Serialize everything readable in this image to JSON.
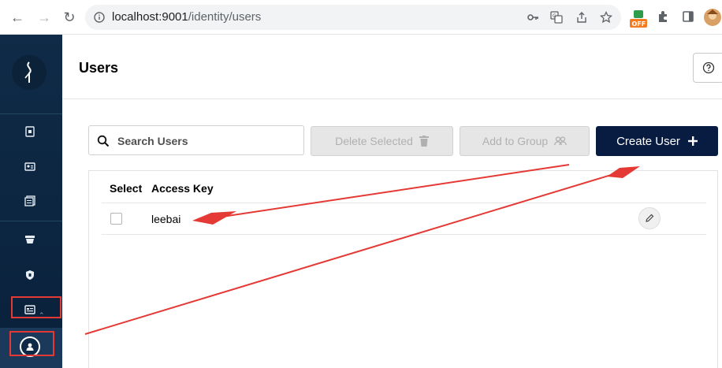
{
  "browser": {
    "url_host": "localhost:9001",
    "url_path": "/identity/users",
    "ext_badge": "OFF"
  },
  "sidebar": {
    "items": [
      {
        "icon": "buckets-icon"
      },
      {
        "icon": "access-keys-icon"
      },
      {
        "icon": "documentation-icon"
      },
      {
        "icon": "tiers-icon"
      },
      {
        "icon": "policies-icon"
      },
      {
        "icon": "identity-icon"
      },
      {
        "icon": "user-avatar-icon"
      }
    ]
  },
  "page": {
    "title": "Users"
  },
  "toolbar": {
    "search_placeholder": "Search Users",
    "delete_label": "Delete Selected",
    "add_group_label": "Add to Group",
    "create_label": "Create User"
  },
  "table": {
    "columns": [
      "Select",
      "Access Key"
    ],
    "rows": [
      {
        "access_key": "leebai"
      }
    ]
  },
  "colors": {
    "sidebar_bg": "#0f2b47",
    "primary_button": "#081c42",
    "annotation_red": "#e53935"
  }
}
